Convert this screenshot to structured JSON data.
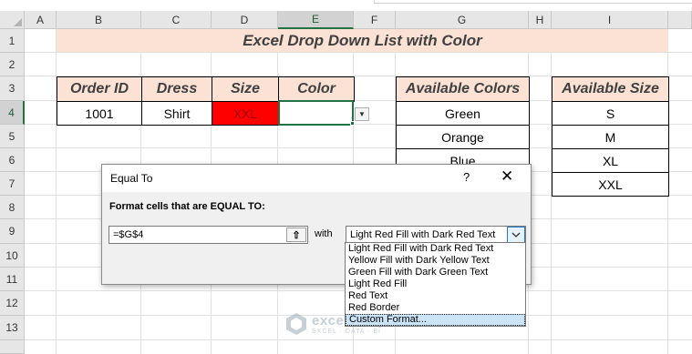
{
  "columns": [
    "A",
    "B",
    "C",
    "D",
    "E",
    "F",
    "G",
    "H",
    "I"
  ],
  "rows": [
    "1",
    "2",
    "3",
    "4",
    "5",
    "6",
    "7",
    "8",
    "9",
    "10",
    "11",
    "12",
    "13"
  ],
  "title": "Excel Drop Down List with Color",
  "order_table": {
    "headers": [
      "Order ID",
      "Dress",
      "Size",
      "Color"
    ],
    "row": [
      "1001",
      "Shirt",
      "XXL",
      ""
    ]
  },
  "available_colors": {
    "header": "Available Colors",
    "items": [
      "Green",
      "Orange",
      "Blue"
    ]
  },
  "available_size": {
    "header": "Available Size",
    "items": [
      "S",
      "M",
      "XL",
      "XXL"
    ]
  },
  "dialog": {
    "title": "Equal To",
    "help": "?",
    "close": "✕",
    "prompt": "Format cells that are EQUAL TO:",
    "value": "=$G$4",
    "with_label": "with",
    "selected_format": "Light Red Fill with Dark Red Text",
    "options": [
      "Light Red Fill with Dark Red Text",
      "Yellow Fill with Dark Yellow Text",
      "Green Fill with Dark Green Text",
      "Light Red Fill",
      "Red Text",
      "Red Border",
      "Custom Format..."
    ]
  },
  "watermark": {
    "name": "exceldemy",
    "tagline": "EXCEL · DATA · BI"
  },
  "colors": {
    "accent": "#217346",
    "header_fill": "#fbe2d5",
    "red_fill": "#ff0000"
  }
}
